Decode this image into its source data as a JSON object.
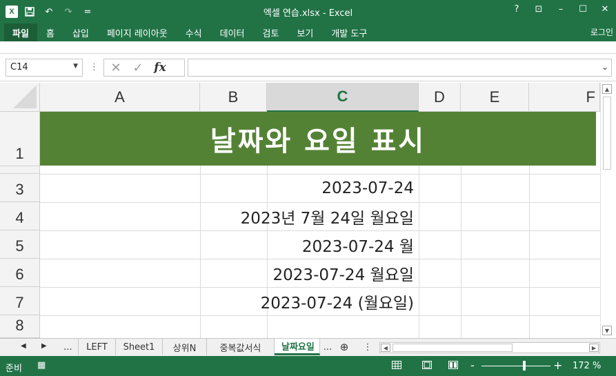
{
  "titlebar": {
    "app_icon_label": "X",
    "undo_glyph": "↶",
    "redo_glyph": "↷",
    "customize_glyph": "=",
    "title": "엑셀 연습.xlsx - Excel",
    "help": "?",
    "ribbon_options": "⊡",
    "minimize": "–",
    "maximize": "☐",
    "close": "✕"
  },
  "ribbon": {
    "tabs": [
      "파일",
      "홈",
      "삽입",
      "페이지 레이아웃",
      "수식",
      "데이터",
      "검토",
      "보기",
      "개발 도구"
    ],
    "login": "로그인"
  },
  "formula_bar": {
    "name_box": "C14",
    "separator": "⋮",
    "cancel_glyph": "✕",
    "enter_glyph": "✓",
    "fx_label": "fx",
    "formula": "",
    "expand_glyph": "⌄"
  },
  "grid": {
    "columns": [
      "A",
      "B",
      "C",
      "D",
      "E",
      "F"
    ],
    "active_column": "C",
    "rows": [
      "1",
      "3",
      "4",
      "5",
      "6",
      "7",
      "8"
    ],
    "title": "날짜와 요일 표시",
    "values": [
      "2023-07-24",
      "2023년 7월 24일 월요일",
      "2023-07-24 월",
      "2023-07-24 월요일",
      "2023-07-24 (월요일)"
    ]
  },
  "sheets": {
    "prev": "◀",
    "next": "▶",
    "more_left": "...",
    "tabs": [
      "LEFT",
      "Sheet1",
      "상위N",
      "중복값서식",
      "날짜요일"
    ],
    "active": "날짜요일",
    "more_right": "...",
    "add": "⊕",
    "options": "⋮"
  },
  "status": {
    "ready": "준비",
    "macro_glyph": "▦",
    "zoom_minus": "-",
    "zoom_plus": "+",
    "zoom": "172 %",
    "zoom_fraction": 0.62
  }
}
